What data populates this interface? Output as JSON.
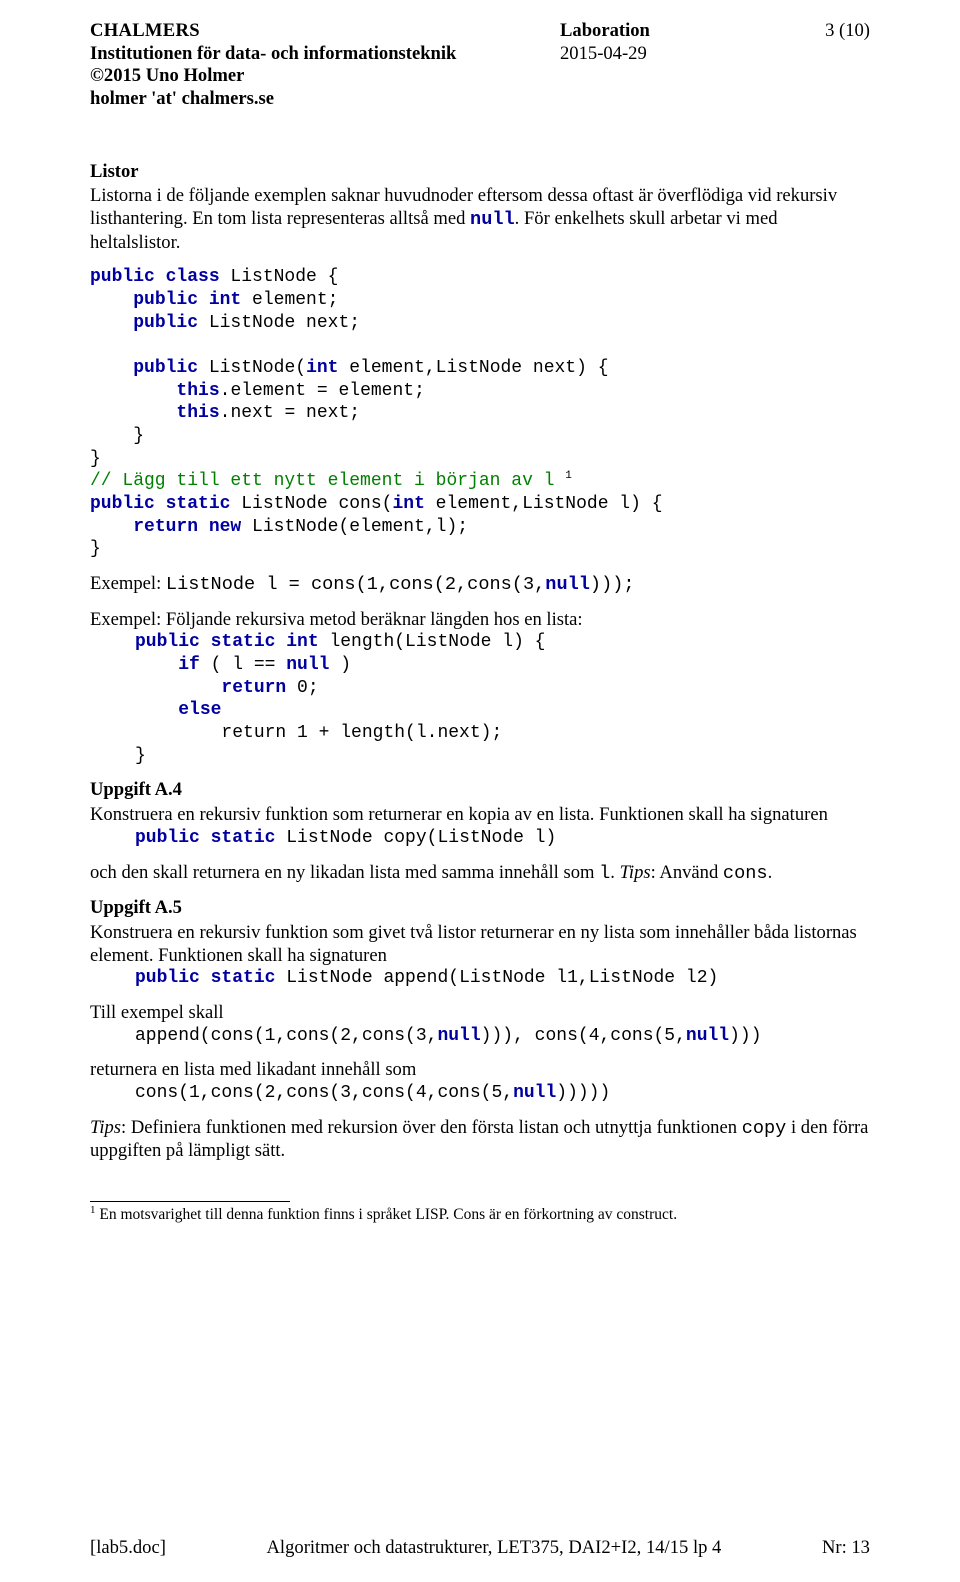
{
  "header": {
    "left": {
      "l1": "CHALMERS",
      "l2": "Institutionen för data- och informationsteknik",
      "l3": "©2015 Uno Holmer",
      "l4": "holmer 'at' chalmers.se"
    },
    "center": {
      "l1": "Laboration",
      "l2": "2015-04-29"
    },
    "right": {
      "page": "3 (10)"
    }
  },
  "listor": {
    "title": "Listor",
    "p1a": "Listorna i de följande exemplen saknar huvudnoder eftersom dessa oftast är överflödiga vid rekursiv listhantering. En tom lista representeras alltså med ",
    "p1b": "null",
    "p1c": ". För enkelhets skull arbetar vi med heltalslistor.",
    "code1_l1": "public class",
    "code1_l1b": " ListNode {",
    "code1_l2": "public int",
    "code1_l2b": " element;",
    "code1_l3": "public",
    "code1_l3b": " ListNode next;",
    "code1_l4": "public",
    "code1_l4b": " ListNode(",
    "code1_l4c": "int",
    "code1_l4d": " element,ListNode next) {",
    "code1_l5": "this",
    "code1_l5b": ".element = element;",
    "code1_l6": "this",
    "code1_l6b": ".next = next;",
    "code1_l7": "    }",
    "code1_l8": "}",
    "comment1": "// Lägg till ett nytt element i början av l",
    "footref": "1",
    "code2_l1": "public static",
    "code2_l1b": " ListNode cons(",
    "code2_l1c": "int",
    "code2_l1d": " element,ListNode l) {",
    "code2_l2": "return new",
    "code2_l2b": " ListNode(element,l);",
    "code2_l3": "}",
    "ex1a": "Exempel: ",
    "ex1b": "ListNode l = cons(1,cons(2,cons(3,",
    "ex1c": "null",
    "ex1d": ")));",
    "ex2": "Exempel: Följande rekursiva metod beräknar längden hos en lista:",
    "code3_l1": "public static int",
    "code3_l1b": " length(ListNode l) {",
    "code3_l2": "if",
    "code3_l2b": " ( l == ",
    "code3_l2c": "null",
    "code3_l2d": " )",
    "code3_l3": "return",
    "code3_l3b": " 0;",
    "code3_l4": "else",
    "code3_l5": "        ",
    "code3_l5b": "return 1 + length(l.next);",
    "code3_l6": "}"
  },
  "a4": {
    "title": "Uppgift A.4",
    "p1": "Konstruera en rekursiv funktion som returnerar en kopia av en lista. Funktionen skall ha signaturen",
    "sig_a": "public static",
    "sig_b": " ListNode copy(ListNode l)",
    "p2a": "och den skall returnera en ny likadan lista med samma innehåll som ",
    "p2b": "l",
    "p2c": ". ",
    "p2d": "Tips",
    "p2e": ": Använd ",
    "p2f": "cons",
    "p2g": "."
  },
  "a5": {
    "title": "Uppgift A.5",
    "p1": "Konstruera en rekursiv funktion som givet två listor returnerar en ny lista som innehåller båda listornas element. Funktionen skall ha signaturen",
    "sig_a": "public static",
    "sig_b": " ListNode append(ListNode l1,ListNode l2)",
    "p2": "Till exempel skall",
    "code_a": "append(cons(1,cons(2,cons(3,",
    "code_b": "null",
    "code_c": "))), cons(4,cons(5,",
    "code_d": "null",
    "code_e": ")))",
    "p3": "returnera en lista med likadant innehåll som",
    "code2_a": "cons(1,cons(2,cons(3,cons(4,cons(5,",
    "code2_b": "null",
    "code2_c": ")))))",
    "p4a": "Tips",
    "p4b": ": Definiera funktionen med rekursion över den första listan och utnyttja funktionen ",
    "p4c": "copy",
    "p4d": " i den förra uppgiften på lämpligt sätt."
  },
  "footnote": {
    "ref": "1",
    "text": " En motsvarighet till denna funktion finns i språket LISP. Cons är en förkortning av construct."
  },
  "footer": {
    "l": "[lab5.doc]",
    "c": "Algoritmer och datastrukturer, LET375, DAI2+I2, 14/15 lp 4",
    "r": "Nr: 13"
  }
}
